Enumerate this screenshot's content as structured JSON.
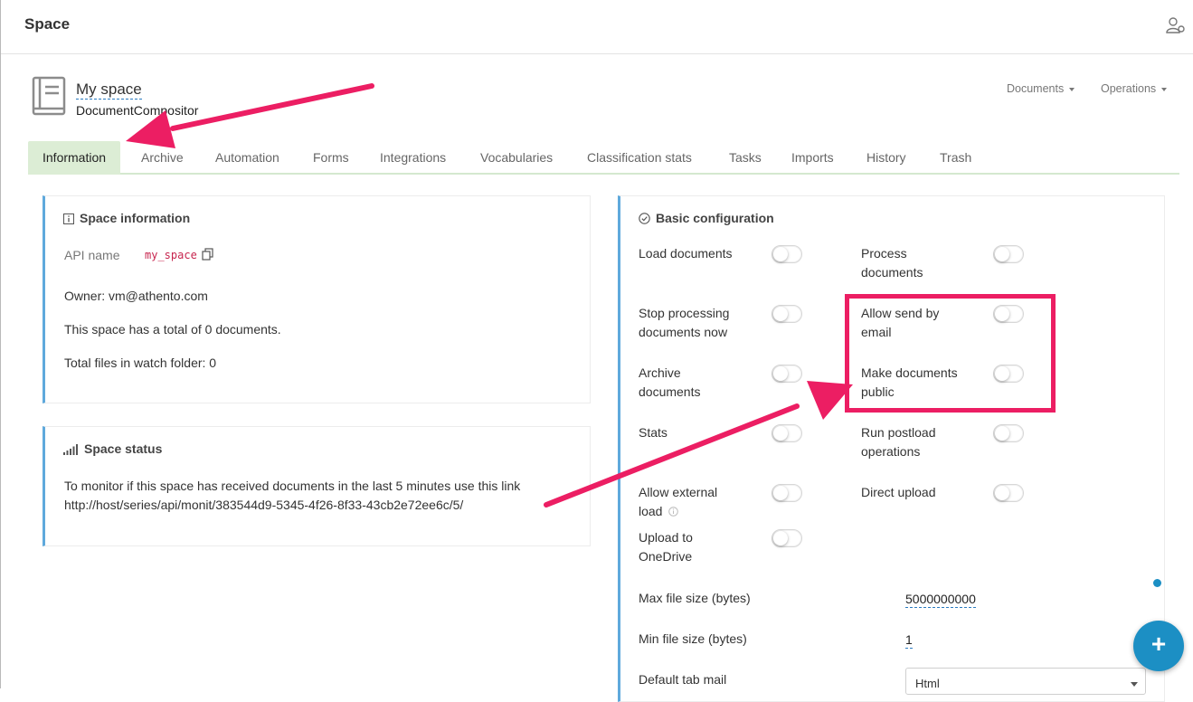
{
  "header": {
    "title": "Space"
  },
  "space": {
    "name": "My space",
    "subtitle": "DocumentCompositor"
  },
  "menus": {
    "documents": "Documents",
    "operations": "Operations"
  },
  "tabs": [
    {
      "label": "Information",
      "active": true
    },
    {
      "label": "Archive"
    },
    {
      "label": "Automation"
    },
    {
      "label": "Forms"
    },
    {
      "label": "Integrations"
    },
    {
      "label": "Vocabularies"
    },
    {
      "label": "Classification stats"
    },
    {
      "label": "Tasks"
    },
    {
      "label": "Imports"
    },
    {
      "label": "History"
    },
    {
      "label": "Trash"
    }
  ],
  "info": {
    "title": "Space information",
    "api_label": "API name",
    "api_value": "my_space",
    "owner": "Owner: vm@athento.com",
    "total": "This space has a total of 0 documents.",
    "watch": "Total files in watch folder: 0"
  },
  "status": {
    "title": "Space status",
    "text": "To monitor if this space has received documents in the last 5 minutes use this link",
    "link": "http://host/series/api/monit/383544d9-5345-4f26-8f33-43cb2e72ee6c/5/"
  },
  "config": {
    "title": "Basic configuration",
    "load": {
      "l1": "Load documents",
      "on": false
    },
    "process": {
      "l1": "Process",
      "l2": "documents",
      "on": false
    },
    "stop": {
      "l1": "Stop processing",
      "l2": "documents now",
      "on": false
    },
    "email": {
      "l1": "Allow send by",
      "l2": "email",
      "on": false
    },
    "archive": {
      "l1": "Archive",
      "l2": "documents",
      "on": false
    },
    "public": {
      "l1": "Make documents",
      "l2": "public",
      "on": false
    },
    "stats": {
      "l1": "Stats",
      "on": false
    },
    "postload": {
      "l1": "Run postload",
      "l2": "operations",
      "on": false
    },
    "external": {
      "l1": "Allow external",
      "l2": "load",
      "on": false
    },
    "direct": {
      "l1": "Direct upload",
      "on": false
    },
    "onedrive": {
      "l1": "Upload to",
      "l2": "OneDrive",
      "on": false
    },
    "max_label": "Max file size (bytes)",
    "max_value": "5000000000",
    "min_label": "Min file size (bytes)",
    "min_value": "1",
    "tabmail_label": "Default tab mail",
    "tabmail_value": "Html"
  },
  "fab": {
    "label": "+"
  },
  "colors": {
    "accent": "#5fa9dc",
    "active_tab": "#dcedd5",
    "annotation": "#ec1e63",
    "fab": "#1c8fc4"
  }
}
